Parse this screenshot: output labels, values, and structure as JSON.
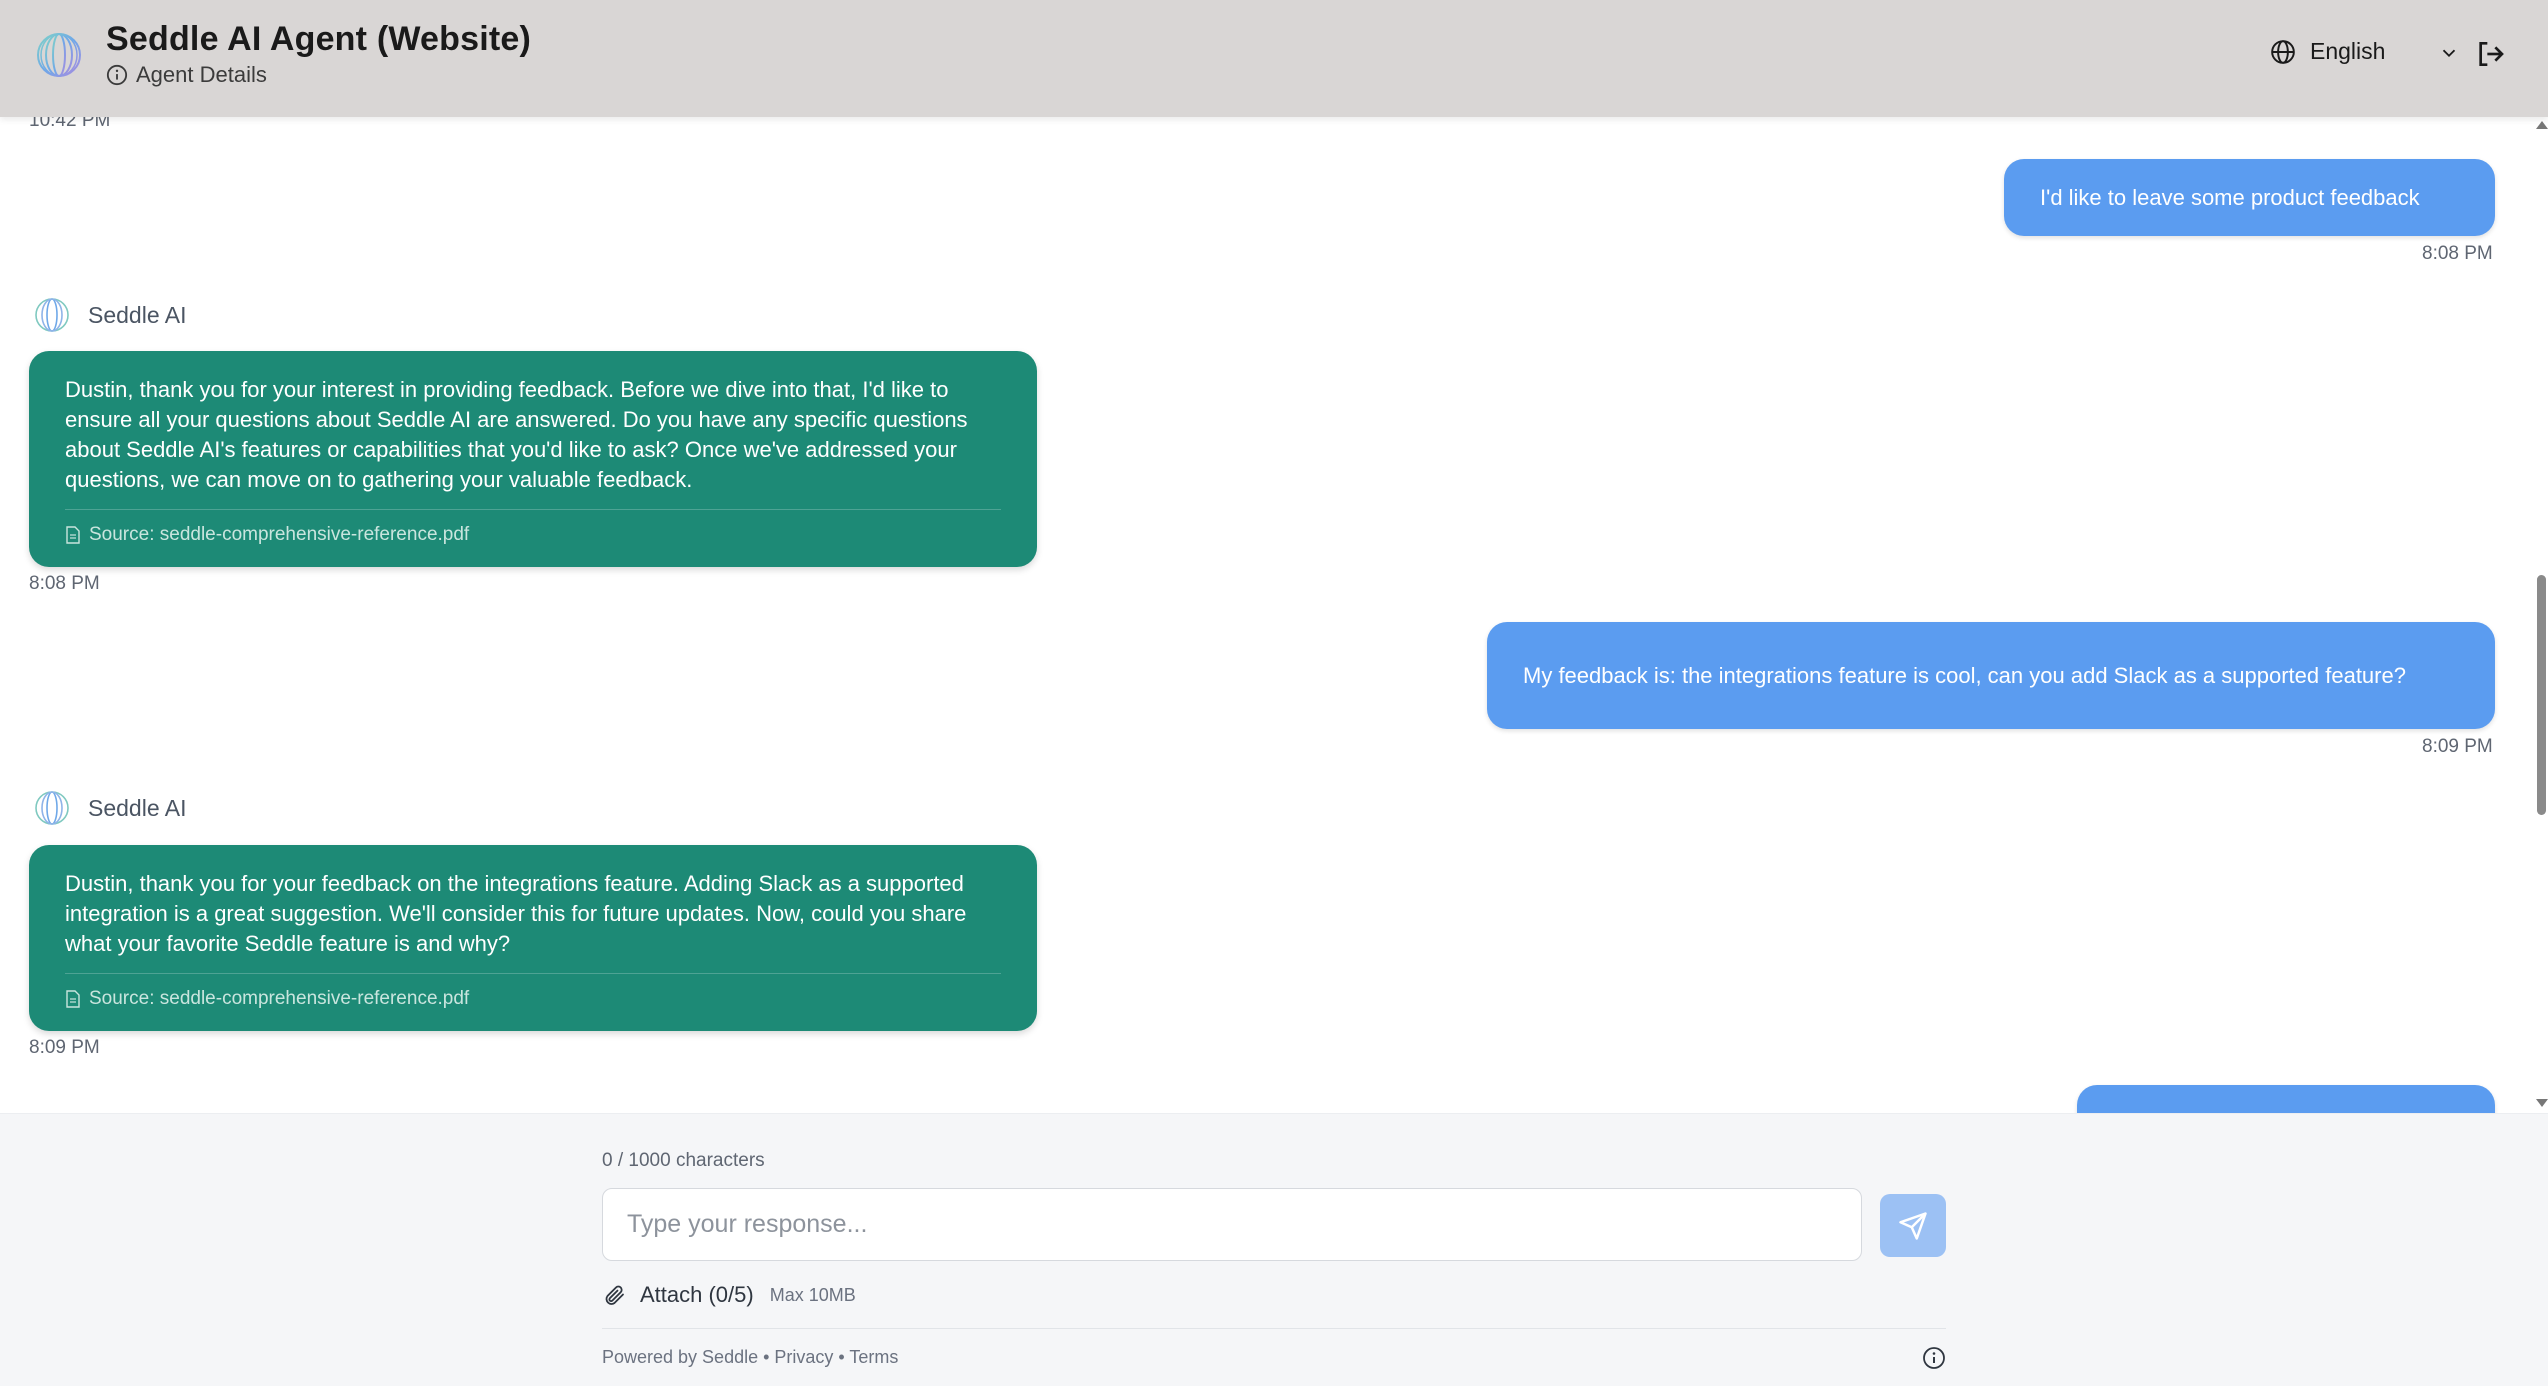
{
  "header": {
    "title": "Seddle AI Agent (Website)",
    "details_label": "Agent Details",
    "language": "English"
  },
  "chat": {
    "top_timestamp": "10:42 PM",
    "messages": [
      {
        "role": "user",
        "text": "I'd like to leave some product feedback",
        "time": "8:08 PM"
      },
      {
        "role": "agent",
        "name": "Seddle AI",
        "text": "Dustin, thank you for your interest in providing feedback. Before we dive into that, I'd like to ensure all your questions about Seddle AI are answered. Do you have any specific questions about Seddle AI's features or capabilities that you'd like to ask? Once we've addressed your questions, we can move on to gathering your valuable feedback.",
        "source": "Source: seddle-comprehensive-reference.pdf",
        "time": "8:08 PM"
      },
      {
        "role": "user",
        "text": "My feedback is: the integrations feature is cool, can you add Slack as a supported feature?",
        "time": "8:09 PM"
      },
      {
        "role": "agent",
        "name": "Seddle AI",
        "text": "Dustin, thank you for your feedback on the integrations feature. Adding Slack as a supported integration is a great suggestion. We'll consider this for future updates. Now, could you share what your favorite Seddle feature is and why?",
        "source": "Source: seddle-comprehensive-reference.pdf",
        "time": "8:09 PM"
      }
    ]
  },
  "composer": {
    "counter": "0 / 1000 characters",
    "placeholder": "Type your response...",
    "attach_label": "Attach (0/5)",
    "attach_max": "Max 10MB",
    "footer_text": "Powered by Seddle • Privacy • Terms"
  },
  "colors": {
    "user_bubble": "#5b9cf0",
    "agent_bubble": "#1d8a76",
    "header_bg": "#d9d6d5",
    "send_button": "#9cc1f4"
  }
}
